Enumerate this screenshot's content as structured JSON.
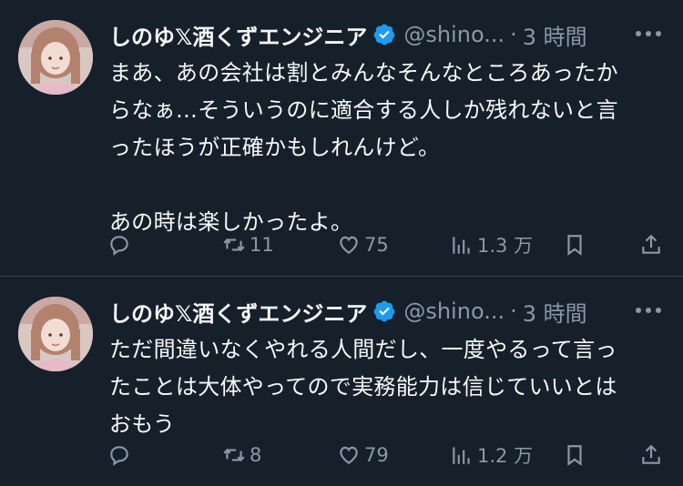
{
  "tweets": [
    {
      "display_name": "しのゆ𝕏酒くずエンジニア",
      "handle": "@shino...",
      "separator": "·",
      "time": "3 時間",
      "text": "まあ、あの会社は割とみんなそんなところあったか\nらなぁ…そういうのに適合する人しか残れないと言\nったほうが正確かもしれんけど。\n\nあの時は楽しかったよ。",
      "replies": "",
      "retweets": "11",
      "likes": "75",
      "views": "1.3 万"
    },
    {
      "display_name": "しのゆ𝕏酒くずエンジニア",
      "handle": "@shino...",
      "separator": "·",
      "time": "3 時間",
      "text": "ただ間違いなくやれる人間だし、一度やるって言っ\nたことは大体やってので実務能力は信じていいとは\nおもう",
      "replies": "",
      "retweets": "8",
      "likes": "79",
      "views": "1.2 万"
    }
  ],
  "icons": {
    "verified": "verified-badge-icon",
    "more": "more-horizontal-icon",
    "reply": "reply-icon",
    "retweet": "retweet-icon",
    "like": "heart-icon",
    "views": "views-bar-icon",
    "bookmark": "bookmark-icon",
    "share": "share-icon"
  },
  "colors": {
    "background": "#15202b",
    "text": "#f7f9f9",
    "secondary": "#8b98a5",
    "verified": "#1d9bf0",
    "divider": "#38444d"
  }
}
